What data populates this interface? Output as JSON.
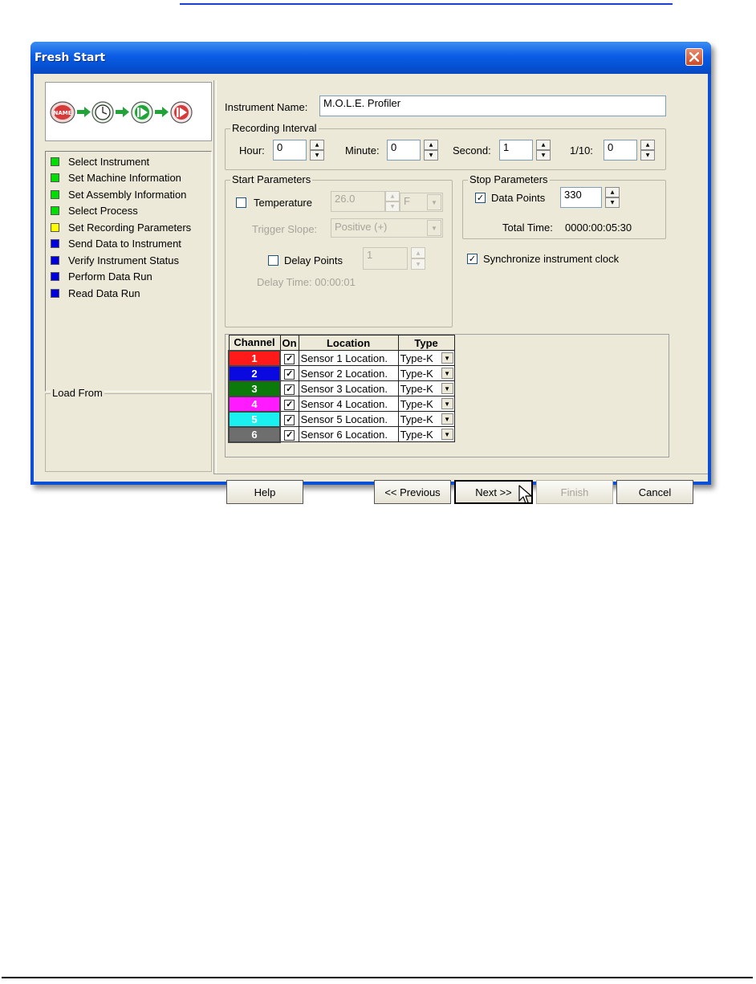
{
  "window": {
    "title": "Fresh Start"
  },
  "logo_icons": [
    {
      "name": "name-icon",
      "color": "#d63a3a",
      "label": "NAME"
    },
    {
      "name": "arrow-right-icon",
      "color": "#22a33a"
    },
    {
      "name": "clock-icon",
      "color": "#22a33a"
    },
    {
      "name": "arrow-right-icon",
      "color": "#22a33a"
    },
    {
      "name": "play-green-icon",
      "color": "#22a33a"
    },
    {
      "name": "arrow-right-icon",
      "color": "#22a33a"
    },
    {
      "name": "play-red-icon",
      "color": "#d63a3a"
    }
  ],
  "steps": [
    {
      "label": "Select Instrument",
      "color": "#00dd00"
    },
    {
      "label": "Set Machine Information",
      "color": "#00dd00"
    },
    {
      "label": "Set Assembly Information",
      "color": "#00dd00"
    },
    {
      "label": "Select Process",
      "color": "#00dd00"
    },
    {
      "label": "Set Recording Parameters",
      "color": "#ffff00"
    },
    {
      "label": "Send Data to Instrument",
      "color": "#0000dd"
    },
    {
      "label": "Verify Instrument Status",
      "color": "#0000dd"
    },
    {
      "label": "Perform Data Run",
      "color": "#0000dd"
    },
    {
      "label": "Read Data Run",
      "color": "#0000dd"
    }
  ],
  "load_from": {
    "label": "Load From"
  },
  "instrument": {
    "label": "Instrument Name:",
    "value": "M.O.L.E. Profiler"
  },
  "recording_interval": {
    "title": "Recording Interval",
    "hour_label": "Hour:",
    "hour": "0",
    "minute_label": "Minute:",
    "minute": "0",
    "second_label": "Second:",
    "second": "1",
    "tenth_label": "1/10:",
    "tenth": "0"
  },
  "start_params": {
    "title": "Start Parameters",
    "temperature_label": "Temperature",
    "temperature_checked": false,
    "temperature_value": "26.0",
    "unit": "F",
    "trigger_label": "Trigger Slope:",
    "trigger_value": "Positive (+)",
    "delay_label": "Delay Points",
    "delay_checked": false,
    "delay_value": "1",
    "delay_time": "Delay Time:  00:00:01"
  },
  "stop_params": {
    "title": "Stop Parameters",
    "data_points_label": "Data Points",
    "data_points_checked": true,
    "data_points_value": "330",
    "total_time_label": "Total Time:",
    "total_time": "0000:00:05:30"
  },
  "sync_clock": {
    "label": "Synchronize instrument clock",
    "checked": true
  },
  "channels": {
    "headers": {
      "channel": "Channel",
      "on": "On",
      "location": "Location",
      "type": "Type"
    },
    "rows": [
      {
        "num": "1",
        "color": "#ff1a1a",
        "on": true,
        "location": "Sensor 1 Location.",
        "type": "Type-K"
      },
      {
        "num": "2",
        "color": "#0a0ae0",
        "on": true,
        "location": "Sensor 2 Location.",
        "type": "Type-K"
      },
      {
        "num": "3",
        "color": "#0b7a0b",
        "on": true,
        "location": "Sensor 3 Location.",
        "type": "Type-K"
      },
      {
        "num": "4",
        "color": "#ff1aff",
        "on": true,
        "location": "Sensor 4 Location.",
        "type": "Type-K"
      },
      {
        "num": "5",
        "color": "#1af0f0",
        "on": true,
        "location": "Sensor 5 Location.",
        "type": "Type-K"
      },
      {
        "num": "6",
        "color": "#6e6e6e",
        "on": true,
        "location": "Sensor 6 Location.",
        "type": "Type-K"
      }
    ]
  },
  "buttons": {
    "help": "Help",
    "previous": "<< Previous",
    "next": "Next >>",
    "finish": "Finish",
    "cancel": "Cancel"
  }
}
